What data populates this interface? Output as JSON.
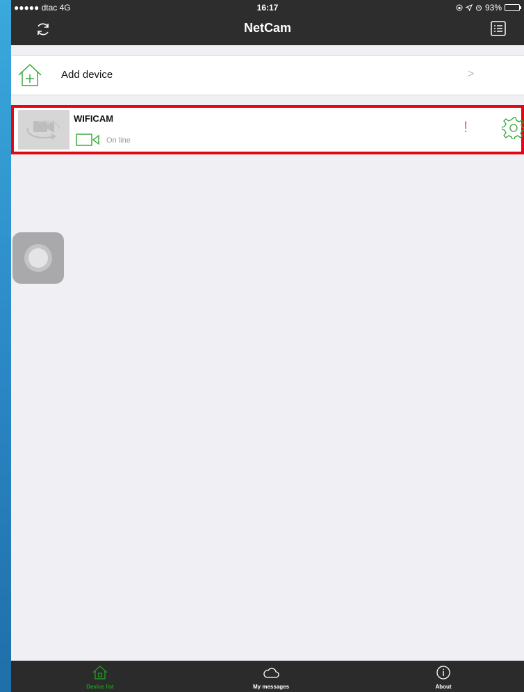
{
  "status_bar": {
    "carrier": "●●●●● dtac  4G",
    "time": "16:17",
    "battery_text": "93%",
    "icons": [
      "lock-rotation-icon",
      "location-icon",
      "alarm-icon",
      "battery-icon"
    ]
  },
  "nav": {
    "title": "NetCam",
    "left_icon": "refresh-icon",
    "right_icon": "list-icon"
  },
  "add_device": {
    "label": "Add device",
    "icon": "add-home-icon",
    "chevron": ">"
  },
  "devices": [
    {
      "name": "WIFICAM",
      "status": "On line",
      "thumbnail_icon": "camera-placeholder-icon",
      "status_icon": "video-camera-icon",
      "alert_symbol": "!",
      "settings_icon": "gear-icon"
    }
  ],
  "tabs": [
    {
      "label": "Device list",
      "icon": "home-icon",
      "active": true
    },
    {
      "label": "My messages",
      "icon": "cloud-icon",
      "active": false
    },
    {
      "label": "About",
      "icon": "info-icon",
      "active": false
    }
  ],
  "colors": {
    "accent_green": "#1f9a1f",
    "highlight_red": "#e30613",
    "bar_dark": "#2d2d2d",
    "background": "#efeff4"
  }
}
